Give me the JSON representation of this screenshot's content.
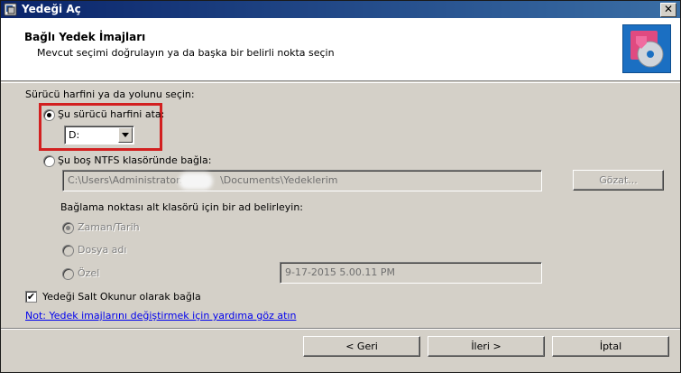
{
  "window": {
    "title": "Yedeği Aç",
    "close_label": "✕"
  },
  "header": {
    "title": "Bağlı Yedek İmajları",
    "subtitle": "Mevcut seçimi doğrulayın ya da başka bir belirli nokta seçin",
    "icon": "media-disc-icon"
  },
  "section": {
    "prompt": "Sürücü harfini ya da yolunu seçin:",
    "option_drive": {
      "label": "Şu sürücü harfini ata:",
      "selected": true
    },
    "drive_select": {
      "value": "D:"
    },
    "option_folder": {
      "label": "Şu boş NTFS klasöründe bağla:",
      "selected": false
    },
    "folder_path_left": "C:\\Users\\Administrator.",
    "folder_path_right": "\\Documents\\Yedeklerim",
    "browse_label": "Gözat...",
    "subfolder_prompt": "Bağlama noktası alt klasörü için bir ad belirleyin:",
    "sub_options": [
      {
        "label": "Zaman/Tarih",
        "selected": true
      },
      {
        "label": "Dosya adı",
        "selected": false
      },
      {
        "label": "Özel",
        "selected": false
      }
    ],
    "custom_value": "9-17-2015 5.00.11 PM",
    "readonly_checkbox": {
      "label": "Yedeği Salt Okunur olarak bağla",
      "checked": true
    },
    "help_link": "Not: Yedek imajlarını değiştirmek için yardıma göz atın"
  },
  "footer": {
    "back_label": "< Geri",
    "next_label": "İleri >",
    "cancel_label": "İptal"
  },
  "colors": {
    "title_bar": "#0a246a",
    "highlight_border": "#d22020",
    "link": "#0000ee"
  }
}
